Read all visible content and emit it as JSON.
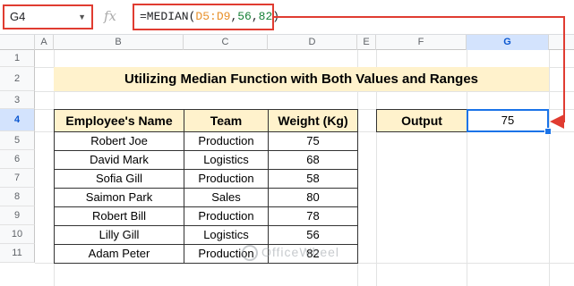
{
  "name_box": {
    "value": "G4"
  },
  "formula_bar": {
    "fx_label": "fx",
    "prefix": "=MEDIAN(",
    "range": "D5:D9",
    "sep1": ",",
    "arg1": "56",
    "sep2": ",",
    "arg2": "82",
    "suffix": ")"
  },
  "columns": [
    "A",
    "B",
    "C",
    "D",
    "E",
    "F",
    "G"
  ],
  "rows": [
    "1",
    "2",
    "3",
    "4",
    "5",
    "6",
    "7",
    "8",
    "9",
    "10",
    "11"
  ],
  "title": "Utilizing Median Function with Both Values and Ranges",
  "table": {
    "headers": [
      "Employee's Name",
      "Team",
      "Weight (Kg)"
    ],
    "rows": [
      [
        "Robert Joe",
        "Production",
        "75"
      ],
      [
        "David Mark",
        "Logistics",
        "68"
      ],
      [
        "Sofia Gill",
        "Production",
        "58"
      ],
      [
        "Saimon Park",
        "Sales",
        "80"
      ],
      [
        "Robert Bill",
        "Production",
        "78"
      ],
      [
        "Lilly Gill",
        "Logistics",
        "56"
      ],
      [
        "Adam Peter",
        "Production",
        "82"
      ]
    ]
  },
  "output": {
    "label": "Output",
    "value": "75"
  },
  "watermark": "OfficeWheel",
  "colors": {
    "highlight_red": "#e03c31",
    "selection_blue": "#1a73e8",
    "header_fill": "#fff2cc"
  }
}
